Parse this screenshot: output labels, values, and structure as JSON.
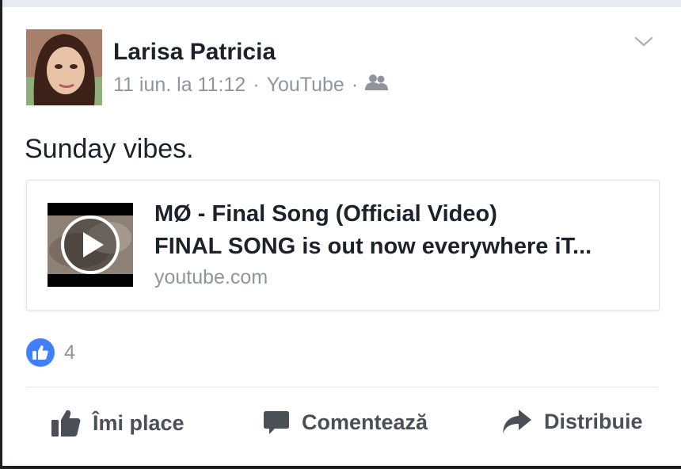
{
  "post": {
    "author": "Larisa Patricia",
    "timestamp": "11 iun. la 11:12",
    "separator": "·",
    "source": "YouTube",
    "audience_icon": "friends-icon",
    "menu_icon": "chevron-down-icon",
    "status_text": "Sunday vibes."
  },
  "link_card": {
    "title": "MØ - Final Song (Official Video)",
    "description": "FINAL SONG is out now everywhere iT...",
    "domain": "youtube.com",
    "thumbnail_icon": "play-icon"
  },
  "reactions": {
    "icon": "like-icon",
    "count": "4"
  },
  "actions": {
    "like_label": "Îmi place",
    "comment_label": "Comentează",
    "share_label": "Distribuie"
  },
  "colors": {
    "text": "#1d2129",
    "meta": "#90949c",
    "like_badge": "#4080ff",
    "action_text": "#4b4f56"
  }
}
